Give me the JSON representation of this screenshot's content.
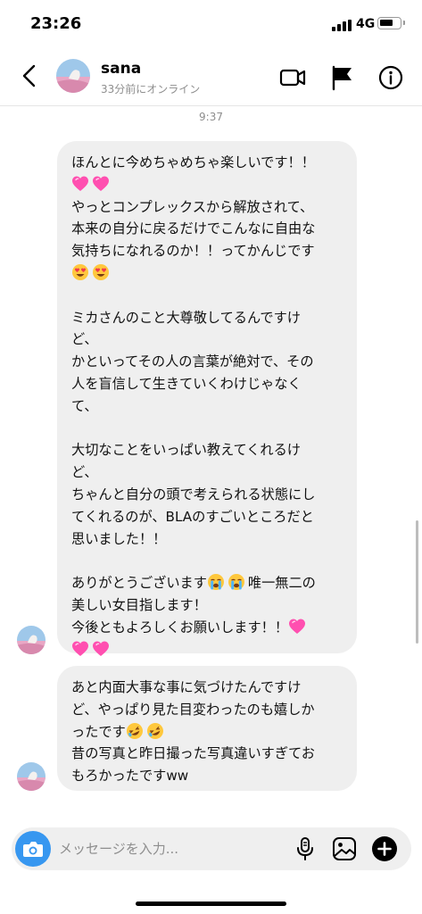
{
  "status_bar": {
    "time": "23:26",
    "network": "4G"
  },
  "header": {
    "contact_name": "sana",
    "contact_status": "33分前にオンライン",
    "icons": [
      "back-chevron-icon",
      "video-camera-icon",
      "flag-icon",
      "info-icon"
    ]
  },
  "conversation": {
    "timestamp": "9:37",
    "messages": [
      {
        "lines": [
          "ほんとに今めちゃめちゃ楽しいです！！",
          "[heart][heart]",
          "やっとコンプレックスから解放されて、",
          "本来の自分に戻るだけでこんなに自由な",
          "気持ちになれるのか！！ってかんじです",
          "[heart-eyes][heart-eyes]",
          "",
          "ミカさんのこと大尊敬してるんですけ",
          "ど、",
          "かといってその人の言葉が絶対で、その",
          "人を盲信して生きていくわけじゃなく",
          "て、",
          "",
          "大切なことをいっぱい教えてくれるけ",
          "ど、",
          "ちゃんと自分の頭で考えられる状態にし",
          "てくれるのが、BLAのすごいところだと",
          "思いました！！",
          "",
          "ありがとうございます[crying][crying]唯一無二の",
          "美しい女目指します！",
          "今後ともよろしくお願いします！！[heart]",
          "[heart][heart]"
        ]
      },
      {
        "lines": [
          "あと内面大事な事に気づけたんですけ",
          "ど、やっぱり見た目変わったのも嬉しか",
          "ったです[rofl][rofl]",
          "昔の写真と昨日撮った写真違いすぎてお",
          "もろかったですww"
        ]
      }
    ]
  },
  "composer": {
    "placeholder": "メッセージを入力...",
    "icons": [
      "camera-icon",
      "microphone-icon",
      "gallery-icon",
      "add-icon"
    ]
  },
  "colors": {
    "accent": "#3797f0",
    "bubble": "#efefef",
    "heart": "#ff4fb0"
  }
}
